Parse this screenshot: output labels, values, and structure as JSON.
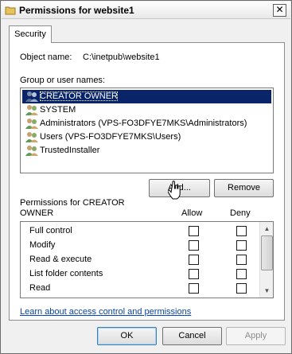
{
  "window": {
    "title": "Permissions for website1",
    "close_label": "✕"
  },
  "tabs": [
    {
      "label": "Security",
      "active": true
    }
  ],
  "object": {
    "label": "Object name:",
    "value": "C:\\inetpub\\website1"
  },
  "groups": {
    "label": "Group or user names:",
    "items": [
      {
        "label": "CREATOR OWNER",
        "selected": true,
        "icon": "user-group-icon"
      },
      {
        "label": "SYSTEM",
        "selected": false,
        "icon": "user-group-icon"
      },
      {
        "label": "Administrators (VPS-FO3DFYE7MKS\\Administrators)",
        "selected": false,
        "icon": "user-group-icon"
      },
      {
        "label": "Users (VPS-FO3DFYE7MKS\\Users)",
        "selected": false,
        "icon": "user-group-icon"
      },
      {
        "label": "TrustedInstaller",
        "selected": false,
        "icon": "user-group-icon"
      }
    ],
    "add_label": "Add...",
    "remove_label": "Remove"
  },
  "permissions": {
    "label_line1": "Permissions for CREATOR",
    "label_line2": "OWNER",
    "allow_header": "Allow",
    "deny_header": "Deny",
    "rows": [
      {
        "name": "Full control",
        "allow": false,
        "deny": false
      },
      {
        "name": "Modify",
        "allow": false,
        "deny": false
      },
      {
        "name": "Read & execute",
        "allow": false,
        "deny": false
      },
      {
        "name": "List folder contents",
        "allow": false,
        "deny": false
      },
      {
        "name": "Read",
        "allow": false,
        "deny": false
      }
    ]
  },
  "help_link": "Learn about access control and permissions",
  "footer": {
    "ok_label": "OK",
    "cancel_label": "Cancel",
    "apply_label": "Apply"
  },
  "colors": {
    "selection": "#0a246a",
    "link": "#0645ad"
  }
}
